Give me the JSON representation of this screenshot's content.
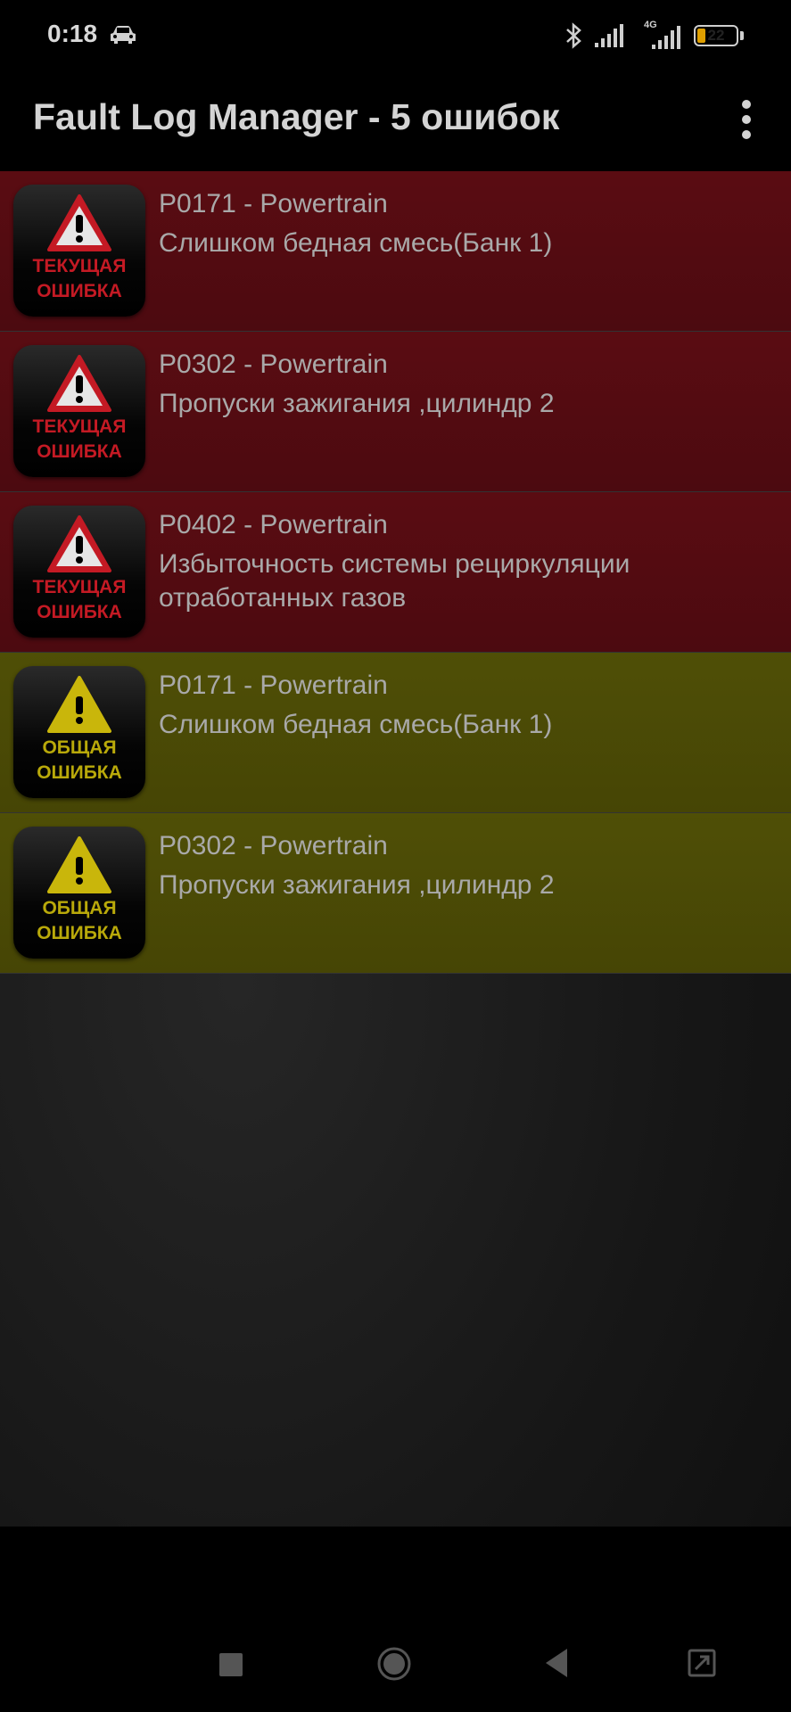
{
  "status_bar": {
    "time": "0:18",
    "car_icon": "car-icon",
    "bluetooth_icon": "bluetooth-icon",
    "network_label": "4G",
    "battery_level": 22,
    "battery_text": "22"
  },
  "app_bar": {
    "title": "Fault Log Manager - 5 ошибок",
    "menu_icon": "more-vert-icon"
  },
  "faults": [
    {
      "code": "P0171 - Powertrain",
      "description": "Слишком бедная смесь(Банк 1)",
      "severity": "current",
      "badge_line1": "ТЕКУЩАЯ",
      "badge_line2": "ОШИБКА"
    },
    {
      "code": "P0302 - Powertrain",
      "description": "Пропуски зажигания ,цилиндр 2",
      "severity": "current",
      "badge_line1": "ТЕКУЩАЯ",
      "badge_line2": "ОШИБКА"
    },
    {
      "code": "P0402 - Powertrain",
      "description": "Избыточность системы рециркуляции отработанных газов",
      "severity": "current",
      "badge_line1": "ТЕКУЩАЯ",
      "badge_line2": "ОШИБКА"
    },
    {
      "code": "P0171 - Powertrain",
      "description": "Слишком бедная смесь(Банк 1)",
      "severity": "general",
      "badge_line1": "ОБЩАЯ",
      "badge_line2": "ОШИБКА"
    },
    {
      "code": "P0302 - Powertrain",
      "description": "Пропуски зажигания ,цилиндр 2",
      "severity": "general",
      "badge_line1": "ОБЩАЯ",
      "badge_line2": "ОШИБКА"
    }
  ],
  "colors": {
    "current_row": "#5a0c12",
    "general_row": "#4f4f06",
    "current_accent": "#c41a24",
    "general_accent": "#b9a90a"
  },
  "nav_bar": {
    "recents_icon": "square-icon",
    "home_icon": "circle-icon",
    "back_icon": "triangle-back-icon",
    "assist_icon": "fullscreen-icon"
  }
}
